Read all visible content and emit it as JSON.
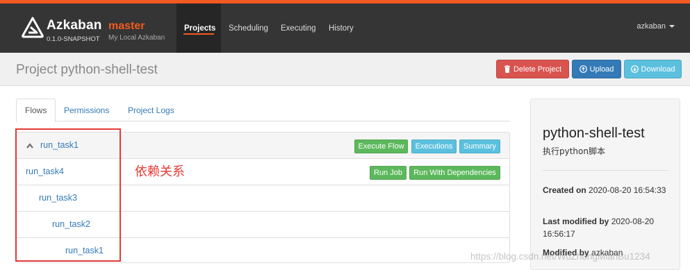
{
  "brand": {
    "name": "Azkaban",
    "env": "master",
    "version": "0.1.0-SNAPSHOT",
    "subtitle": "My Local Azkaban"
  },
  "nav": {
    "items": [
      "Projects",
      "Scheduling",
      "Executing",
      "History"
    ],
    "active": "Projects"
  },
  "user": {
    "name": "azkaban"
  },
  "page": {
    "title": "Project python-shell-test"
  },
  "actions": {
    "delete": {
      "label": "Delete Project",
      "icon": "trash-icon"
    },
    "upload": {
      "label": "Upload",
      "icon": "upload-icon"
    },
    "download": {
      "label": "Download",
      "icon": "download-icon"
    }
  },
  "tabs": [
    "Flows",
    "Permissions",
    "Project Logs"
  ],
  "flows": {
    "root": {
      "name": "run_task1",
      "buttons": [
        "Execute Flow",
        "Executions",
        "Summary"
      ]
    },
    "job_buttons": [
      "Run Job",
      "Run With Dependencies"
    ],
    "jobs": [
      "run_task4",
      "run_task3",
      "run_task2",
      "run_task1"
    ]
  },
  "annotation": "依赖关系",
  "project": {
    "name": "python-shell-test",
    "description": "执行python脚本",
    "created_label": "Created on",
    "created_value": "2020-08-20 16:54:33",
    "modified_label": "Last modified by",
    "modified_value": "2020-08-20 16:56:17",
    "modified_by_label": "Modified by",
    "modified_by_value": "azkaban"
  },
  "watermark": "https://blog.csdn.net/WuZhongMianBu1234",
  "colors": {
    "accent": "#f25a1f",
    "navbar": "#353535",
    "link": "#337ab7",
    "danger": "#d9534f",
    "success": "#5cb85c",
    "info": "#5bc0de"
  }
}
